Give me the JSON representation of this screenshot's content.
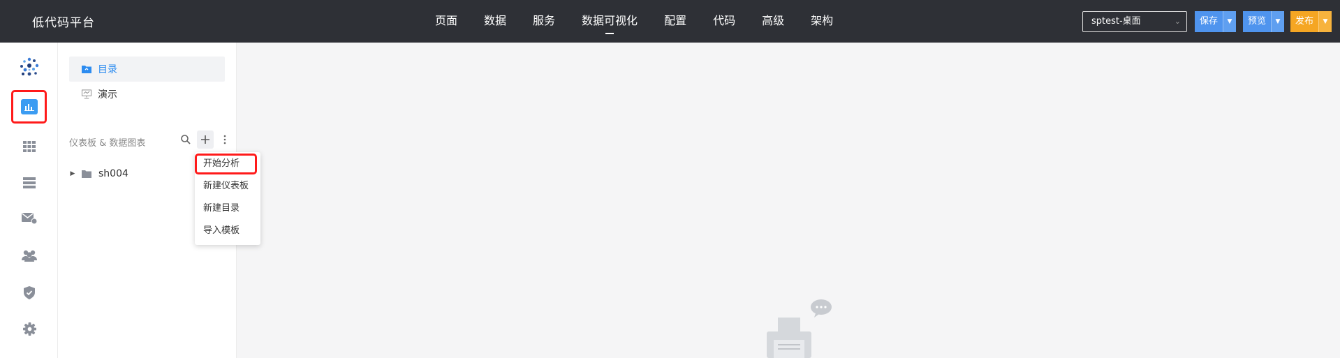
{
  "header": {
    "app_title": "低代码平台",
    "nav": [
      "页面",
      "数据",
      "服务",
      "数据可视化",
      "配置",
      "代码",
      "高级",
      "架构"
    ],
    "active_nav": "数据可视化",
    "app_select": "sptest-桌面",
    "save_label": "保存",
    "preview_label": "预览",
    "publish_label": "发布"
  },
  "sidebar": {
    "icons": [
      "dots-logo-icon",
      "chart-dashboard-icon",
      "grid-table-icon",
      "list-icon",
      "mail-icon",
      "users-icon",
      "shield-icon",
      "gear-icon"
    ],
    "selected": "chart-dashboard-icon"
  },
  "panel": {
    "menu": [
      {
        "label": "目录",
        "icon": "folder-icon",
        "active": true
      },
      {
        "label": "演示",
        "icon": "presentation-icon",
        "active": false
      }
    ],
    "section_title": "仪表板 & 数据图表",
    "tree": [
      {
        "label": "sh004",
        "icon": "folder-icon"
      }
    ]
  },
  "popup_menu": {
    "items": [
      "开始分析",
      "新建仪表板",
      "新建目录",
      "导入模板"
    ],
    "highlighted": "开始分析"
  },
  "colors": {
    "header_bg": "#2e3036",
    "accent": "#2d8cf0",
    "save_btn": "#4f94ee",
    "publish_btn": "#f5a623",
    "highlight_border": "#ff1a1a"
  }
}
